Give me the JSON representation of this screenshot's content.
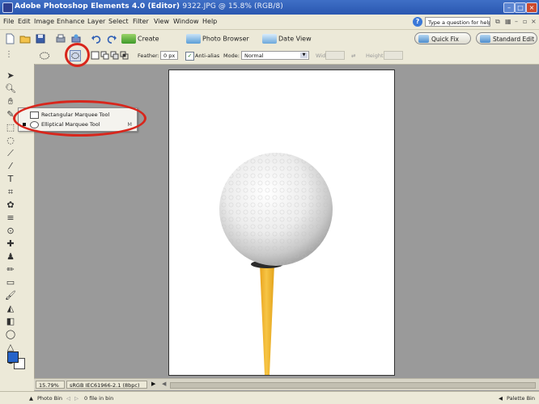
{
  "app_title": "Adobe Photoshop Elements 4.0 (Editor)",
  "doc_title": "9322.JPG @ 15.8% (RGB/8)",
  "menus": [
    "File",
    "Edit",
    "Image",
    "Enhance",
    "Layer",
    "Select",
    "Filter",
    "View",
    "Window",
    "Help"
  ],
  "help_placeholder": "Type a question for help",
  "shortcuts": {
    "create": "Create",
    "photo_browser": "Photo Browser",
    "date_view": "Date View",
    "quick_fix": "Quick Fix",
    "standard_edit": "Standard Edit"
  },
  "options": {
    "feather_label": "Feather:",
    "feather_value": "0 px",
    "antialias_label": "Anti-alias",
    "mode_label": "Mode:",
    "mode_value": "Normal",
    "width_label": "Width:",
    "height_label": "Height:"
  },
  "flyout": {
    "items": [
      {
        "label": "Rectangular Marquee Tool",
        "shortcut": ""
      },
      {
        "label": "Elliptical Marquee Tool",
        "shortcut": "M"
      }
    ]
  },
  "status": {
    "zoom": "15.79%",
    "doc_info": "sRGB IEC61966-2.1 (8bpc)"
  },
  "bottombar": {
    "photo_bin": "Photo Bin",
    "file_count": "0 file in bin",
    "palette_bin": "Palette Bin"
  },
  "colors": {
    "title_bar": "#2a57b0",
    "annotation_red": "#d8261c",
    "workspace_gray": "#9a9a9a",
    "tee_yellow": "#f0b428",
    "foreground_color": "#2563c8"
  }
}
